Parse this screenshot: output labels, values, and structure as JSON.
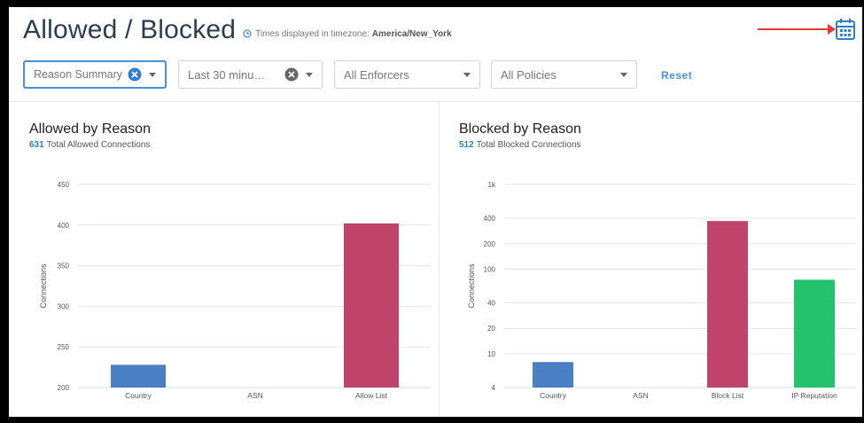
{
  "header": {
    "title": "Allowed / Blocked",
    "timezone_prefix": "Times displayed in timezone:",
    "timezone_value": "America/New_York",
    "calendar_icon": "calendar-icon",
    "annotation_color": "#e53935"
  },
  "filters": {
    "reason": "Reason Summary",
    "time": "Last 30 minu…",
    "enforcers": "All Enforcers",
    "policies": "All Policies",
    "reset": "Reset"
  },
  "colors": {
    "accent": "#4a90d9",
    "country": "#4a7fc4",
    "list": "#c0436c",
    "ip_reputation": "#25c26e"
  },
  "allowed": {
    "title": "Allowed by Reason",
    "total": "631",
    "total_label": "Total Allowed Connections"
  },
  "blocked": {
    "title": "Blocked by Reason",
    "total": "512",
    "total_label": "Total Blocked Connections"
  },
  "chart_data": [
    {
      "type": "bar",
      "title": "Allowed by Reason",
      "ylabel": "Connections",
      "xlabel": "",
      "scale": "linear",
      "ylim": [
        200,
        450
      ],
      "yticks": [
        200,
        250,
        300,
        350,
        400,
        450
      ],
      "tick_labels": [
        "200",
        "250",
        "300",
        "350",
        "400",
        "450"
      ],
      "categories": [
        "Country",
        "ASN",
        "Allow List"
      ],
      "values": [
        228,
        0,
        402
      ],
      "colors": [
        "#4a7fc4",
        "#4a7fc4",
        "#c0436c"
      ],
      "grid": true
    },
    {
      "type": "bar",
      "title": "Blocked by Reason",
      "ylabel": "Connections",
      "xlabel": "",
      "scale": "log",
      "ylim": [
        4,
        1000
      ],
      "yticks": [
        4,
        10,
        20,
        40,
        100,
        200,
        400,
        1000
      ],
      "tick_labels": [
        "4",
        "10",
        "20",
        "40",
        "100",
        "200",
        "400",
        "1k"
      ],
      "categories": [
        "Country",
        "ASN",
        "Block List",
        "IP Reputation"
      ],
      "values": [
        8,
        0,
        370,
        75
      ],
      "colors": [
        "#4a7fc4",
        "#4a7fc4",
        "#c0436c",
        "#25c26e"
      ],
      "grid": true
    }
  ]
}
